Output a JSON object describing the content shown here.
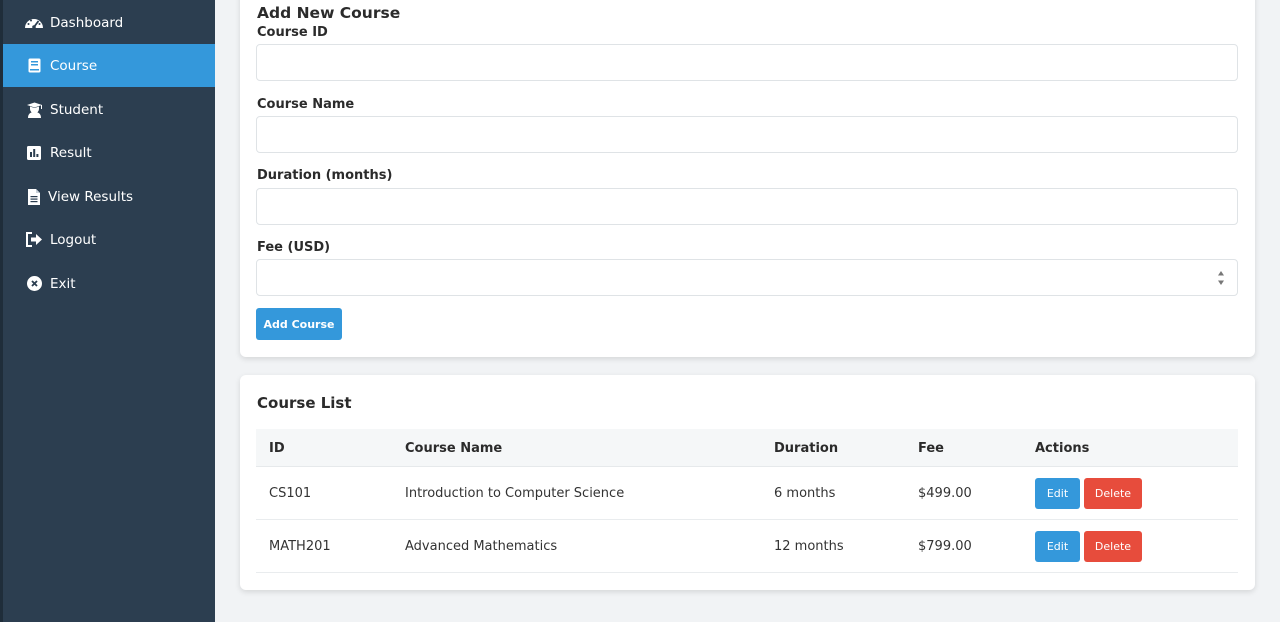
{
  "sidebar": {
    "items": [
      {
        "label": "Dashboard",
        "icon": "gauge-icon",
        "active": false
      },
      {
        "label": "Course",
        "icon": "book-icon",
        "active": true
      },
      {
        "label": "Student",
        "icon": "graduation-cap-icon",
        "active": false
      },
      {
        "label": "Result",
        "icon": "bar-chart-icon",
        "active": false
      },
      {
        "label": "View Results",
        "icon": "document-icon",
        "active": false
      },
      {
        "label": "Logout",
        "icon": "sign-out-icon",
        "active": false
      },
      {
        "label": "Exit",
        "icon": "close-circle-icon",
        "active": false
      }
    ]
  },
  "form": {
    "title": "Add New Course",
    "fields": [
      {
        "label": "Course ID",
        "value": ""
      },
      {
        "label": "Course Name",
        "value": ""
      },
      {
        "label": "Duration (months)",
        "value": ""
      },
      {
        "label": "Fee (USD)",
        "value": ""
      }
    ],
    "submit_label": "Add Course"
  },
  "course_list": {
    "title": "Course List",
    "columns": [
      "ID",
      "Course Name",
      "Duration",
      "Fee",
      "Actions"
    ],
    "rows": [
      {
        "id": "CS101",
        "name": "Introduction to Computer Science",
        "duration": "6 months",
        "fee": "$499.00"
      },
      {
        "id": "MATH201",
        "name": "Advanced Mathematics",
        "duration": "12 months",
        "fee": "$799.00"
      }
    ],
    "edit_label": "Edit",
    "delete_label": "Delete"
  },
  "colors": {
    "sidebar_bg": "#2c3e50",
    "accent": "#3498db",
    "danger": "#e74c3c"
  }
}
